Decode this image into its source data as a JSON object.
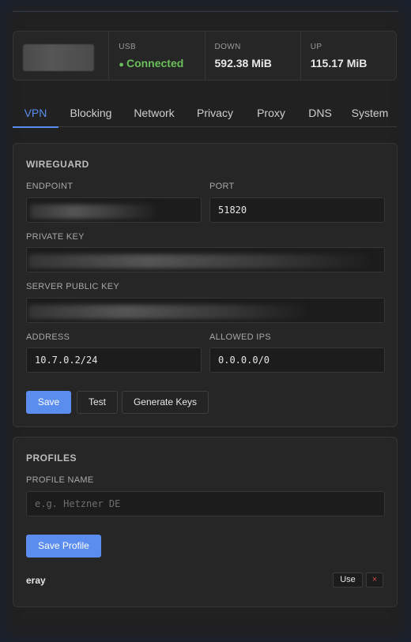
{
  "status": {
    "device_label": "",
    "usb_label": "USB",
    "usb_value": "Connected",
    "down_label": "DOWN",
    "down_value": "592.38 MiB",
    "up_label": "UP",
    "up_value": "115.17 MiB"
  },
  "tabs": [
    {
      "label": "VPN",
      "active": true
    },
    {
      "label": "Blocking"
    },
    {
      "label": "Network"
    },
    {
      "label": "Privacy"
    },
    {
      "label": "Proxy"
    },
    {
      "label": "DNS"
    },
    {
      "label": "System"
    }
  ],
  "wireguard": {
    "title": "WIREGUARD",
    "endpoint_label": "ENDPOINT",
    "endpoint_value": "",
    "port_label": "PORT",
    "port_value": "51820",
    "private_key_label": "PRIVATE KEY",
    "private_key_value": "",
    "server_public_key_label": "SERVER PUBLIC KEY",
    "server_public_key_value": "",
    "address_label": "ADDRESS",
    "address_value": "10.7.0.2/24",
    "allowed_ips_label": "ALLOWED IPS",
    "allowed_ips_value": "0.0.0.0/0",
    "save_label": "Save",
    "test_label": "Test",
    "generate_keys_label": "Generate Keys"
  },
  "profiles": {
    "title": "PROFILES",
    "profile_name_label": "PROFILE NAME",
    "profile_name_placeholder": "e.g. Hetzner DE",
    "save_profile_label": "Save Profile",
    "items": [
      {
        "name": "eray",
        "use_label": "Use",
        "delete_label": "×"
      }
    ]
  },
  "colors": {
    "accent": "#5b8dee",
    "connected": "#6bbf5b",
    "delete": "#d24c4c"
  }
}
